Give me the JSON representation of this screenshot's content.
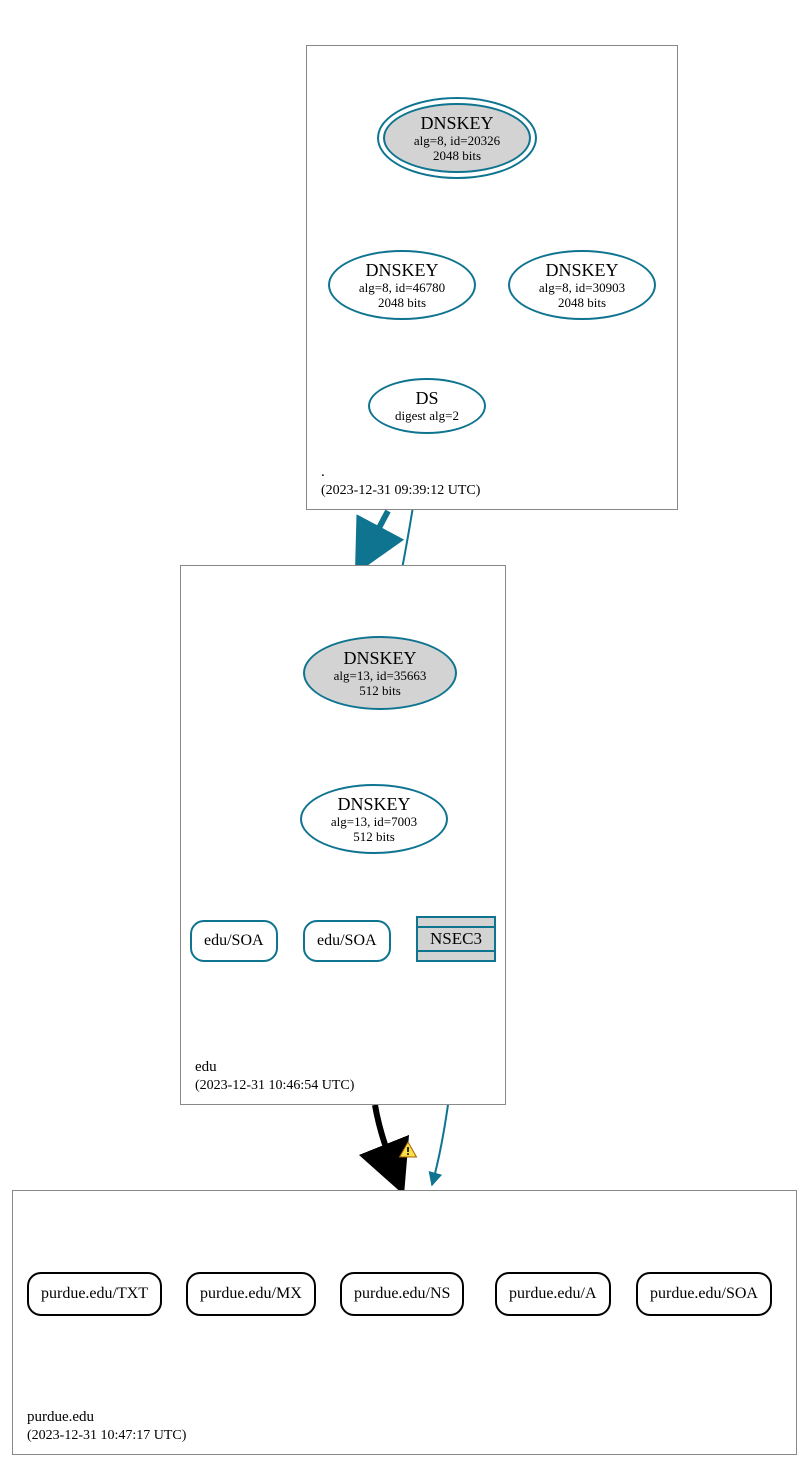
{
  "colors": {
    "teal": "#0E7490",
    "grey_fill": "#d3d3d3",
    "box_border": "#888888",
    "black": "#000000",
    "warn_bg": "#FDE047",
    "warn_border": "#a16207"
  },
  "zones": {
    "root": {
      "name": ".",
      "timestamp": "(2023-12-31 09:39:12 UTC)"
    },
    "tld": {
      "name": "edu",
      "timestamp": "(2023-12-31 10:46:54 UTC)"
    },
    "dom": {
      "name": "purdue.edu",
      "timestamp": "(2023-12-31 10:47:17 UTC)"
    }
  },
  "nodes": {
    "root_ksk": {
      "title": "DNSKEY",
      "line1": "alg=8, id=20326",
      "line2": "2048 bits"
    },
    "root_zsk1": {
      "title": "DNSKEY",
      "line1": "alg=8, id=46780",
      "line2": "2048 bits"
    },
    "root_zsk2": {
      "title": "DNSKEY",
      "line1": "alg=8, id=30903",
      "line2": "2048 bits"
    },
    "root_ds": {
      "title": "DS",
      "line1": "digest alg=2"
    },
    "edu_ksk": {
      "title": "DNSKEY",
      "line1": "alg=13, id=35663",
      "line2": "512 bits"
    },
    "edu_zsk": {
      "title": "DNSKEY",
      "line1": "alg=13, id=7003",
      "line2": "512 bits"
    },
    "edu_soa1": {
      "label": "edu/SOA"
    },
    "edu_soa2": {
      "label": "edu/SOA"
    },
    "edu_nsec3": {
      "label": "NSEC3"
    },
    "purdue_txt": {
      "label": "purdue.edu/TXT"
    },
    "purdue_mx": {
      "label": "purdue.edu/MX"
    },
    "purdue_ns": {
      "label": "purdue.edu/NS"
    },
    "purdue_a": {
      "label": "purdue.edu/A"
    },
    "purdue_soa": {
      "label": "purdue.edu/SOA"
    }
  },
  "warning_icon": "warning"
}
